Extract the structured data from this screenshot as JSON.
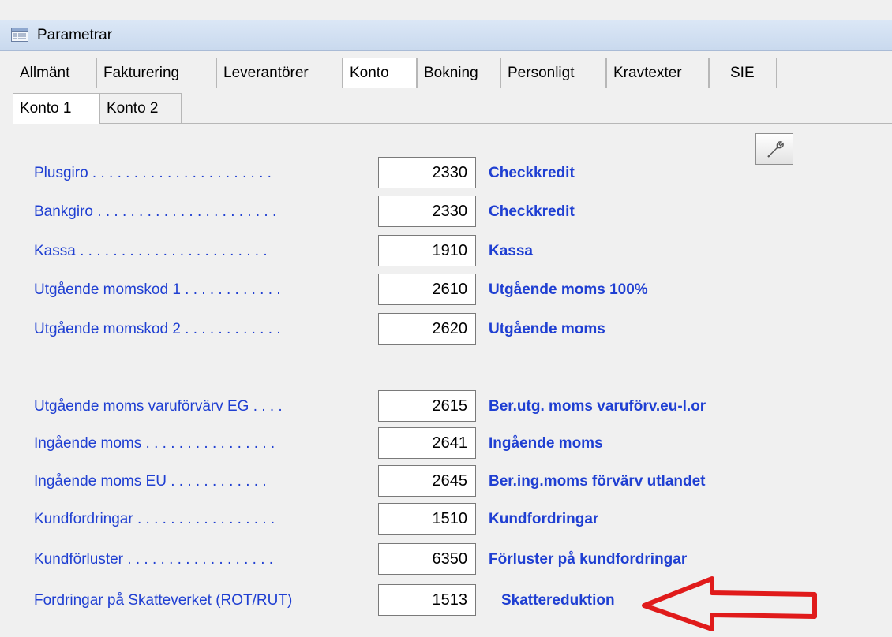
{
  "window": {
    "title": "Parametrar",
    "icon": "list-window-icon"
  },
  "tabs": [
    {
      "label": "Allmänt"
    },
    {
      "label": "Fakturering"
    },
    {
      "label": "Leverantörer"
    },
    {
      "label": "Konto",
      "active": true
    },
    {
      "label": "Bokning"
    },
    {
      "label": "Personligt"
    },
    {
      "label": "Kravtexter"
    },
    {
      "label": "SIE"
    }
  ],
  "subtabs": [
    {
      "label": "Konto 1",
      "active": true
    },
    {
      "label": "Konto 2"
    }
  ],
  "tool_button": {
    "icon": "wrench-icon"
  },
  "accounts": [
    {
      "label": "Plusgiro . . . . . . . . . . . . . . . . . . . . . .",
      "value": "2330",
      "desc": "Checkkredit"
    },
    {
      "label": "Bankgiro . . . . . . . . . . . . . . . . . . . . . .",
      "value": "2330",
      "desc": "Checkkredit"
    },
    {
      "label": "Kassa . . . . . . . . . . . . . . . . . . . . . . .",
      "value": "1910",
      "desc": "Kassa"
    },
    {
      "label": "Utgående momskod 1 . . . . . . . . . . . .",
      "value": "2610",
      "desc": "Utgående moms 100%"
    },
    {
      "label": "Utgående momskod 2 . . . . . . . . . . . .",
      "value": "2620",
      "desc": "Utgående moms"
    },
    {
      "label": "Utgående moms varuförvärv EG . . . .",
      "value": "2615",
      "desc": "Ber.utg. moms varuförv.eu-l.or"
    },
    {
      "label": "Ingående moms . . . . . . . . . . . . . . . .",
      "value": "2641",
      "desc": "Ingående moms"
    },
    {
      "label": "Ingående moms EU . . . . . . . . . . . .",
      "value": "2645",
      "desc": "Ber.ing.moms förvärv utlandet"
    },
    {
      "label": "Kundfordringar . . . . . . . . . . . . . . . . .",
      "value": "1510",
      "desc": "Kundfordringar"
    },
    {
      "label": "Kundförluster . . . . . . . . . . . . . . . . . .",
      "value": "6350",
      "desc": "Förluster på kundfordringar"
    },
    {
      "label": "Fordringar på Skatteverket (ROT/RUT)",
      "value": "1513",
      "desc": "Skattereduktion"
    }
  ],
  "annotation": {
    "color": "#e01b1b"
  }
}
